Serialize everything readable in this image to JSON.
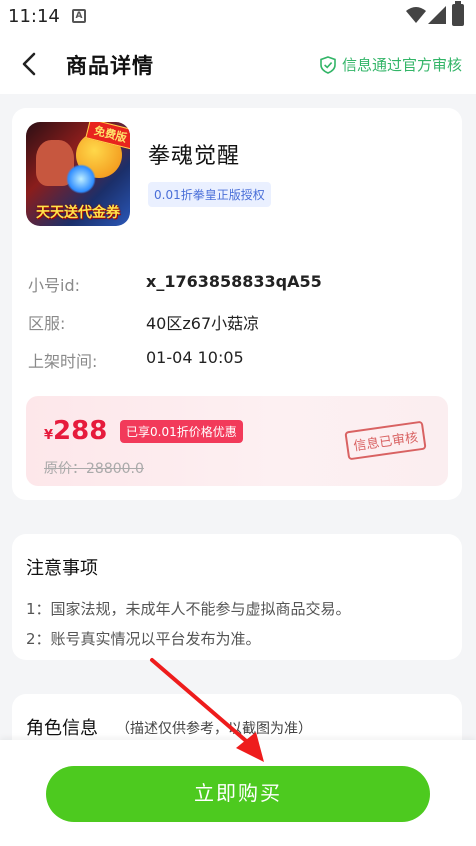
{
  "status_bar": {
    "time": "11:14",
    "icon": "A"
  },
  "navbar": {
    "title": "商品详情",
    "verified_text": "信息通过官方审核"
  },
  "product": {
    "game_name": "拳魂觉醒",
    "auth_tag": "0.01折拳皇正版授权",
    "icon_ribbon": "免费版",
    "icon_banner": "天天送代金券",
    "info": [
      {
        "label": "小号id:",
        "value": "x_1763858833qA55"
      },
      {
        "label": "区服:",
        "value": "40区z67小菇凉"
      },
      {
        "label": "上架时间:",
        "value": "01-04 10:05"
      }
    ],
    "price_currency": "¥",
    "price": "288",
    "discount_tag": "已享0.01折价格优惠",
    "original_price": "原价：28800.0",
    "stamp": "信息已审核"
  },
  "notice": {
    "title": "注意事项",
    "lines": [
      "1：国家法规，未成年人不能参与虚拟商品交易。",
      "2：账号真实情况以平台发布为准。"
    ]
  },
  "role": {
    "title": "角色信息",
    "note": "（描述仅供参考，以截图为准）"
  },
  "buy_button": "立即购买",
  "colors": {
    "accent_green": "#4dca1f",
    "verified_green": "#33b568",
    "price_red": "#e61b3c"
  }
}
